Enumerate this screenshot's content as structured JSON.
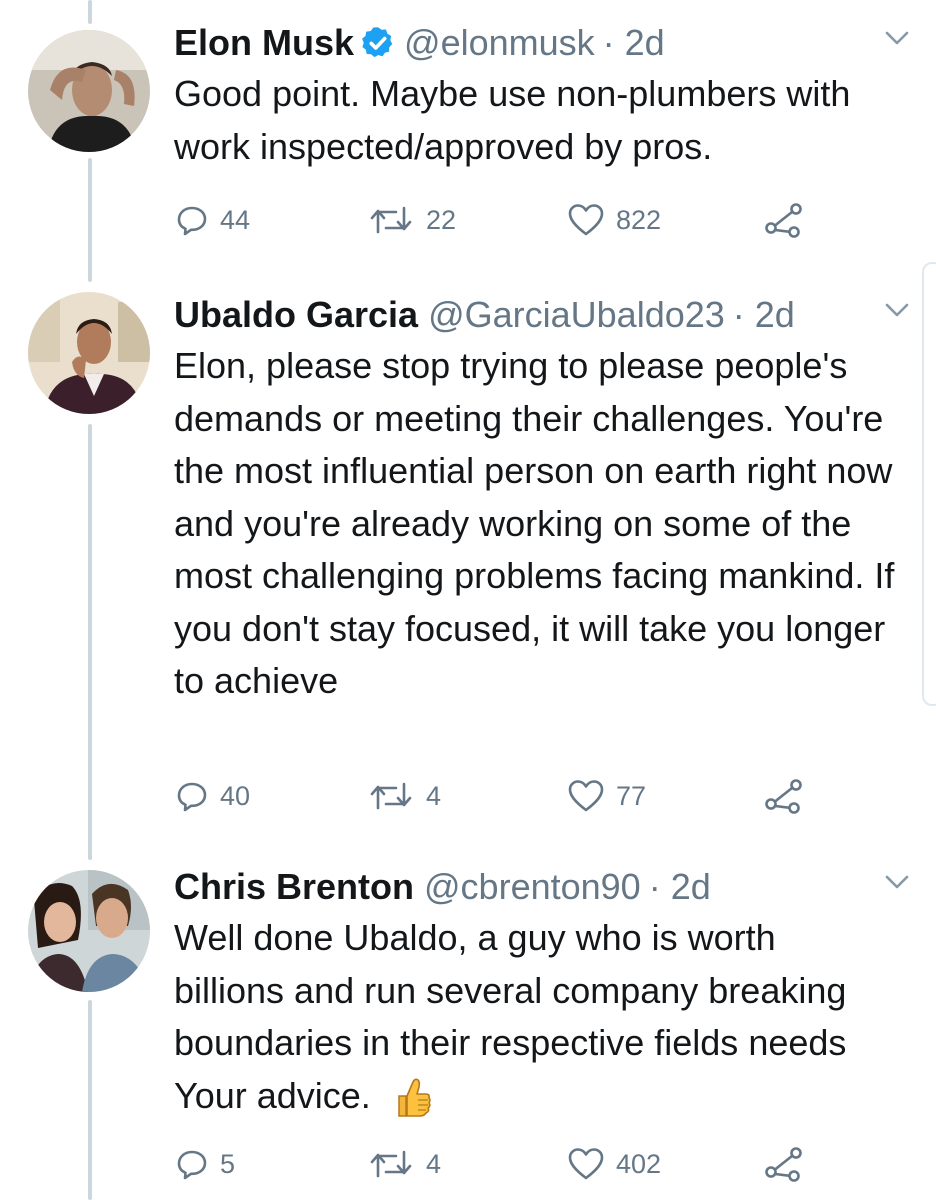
{
  "tweets": [
    {
      "name": "Elon Musk",
      "verified": true,
      "handle": "@elonmusk",
      "time": "· 2d",
      "body": "Good point. Maybe use non-plumbers with work inspected/approved by pros.",
      "replies": "44",
      "retweets": "22",
      "likes": "822"
    },
    {
      "name": "Ubaldo Garcia",
      "verified": false,
      "handle": "@GarciaUbaldo23",
      "time": "· 2d",
      "body": "Elon, please stop trying to please people's demands or meeting their challenges. You're the most influential person on earth right now and you're already working on some of the most challenging problems facing mankind. If you don't stay focused, it will take you longer to achieve",
      "replies": "40",
      "retweets": "4",
      "likes": "77"
    },
    {
      "name": "Chris Brenton",
      "verified": false,
      "handle": "@cbrenton90",
      "time": "· 2d",
      "body": "Well done Ubaldo, a guy who is worth billions and run several company breaking boundaries in their respective fields needs Your advice.",
      "emoji": "thumbs-up",
      "replies": "5",
      "retweets": "4",
      "likes": "402"
    }
  ],
  "colors": {
    "text": "#14171a",
    "secondary": "#657786",
    "thread_line": "#ccd6dd",
    "verified": "#1da1f2"
  },
  "icons": [
    "verified-badge-icon",
    "chevron-down-icon",
    "reply-icon",
    "retweet-icon",
    "like-icon",
    "share-icon",
    "thumbs-up-emoji"
  ]
}
